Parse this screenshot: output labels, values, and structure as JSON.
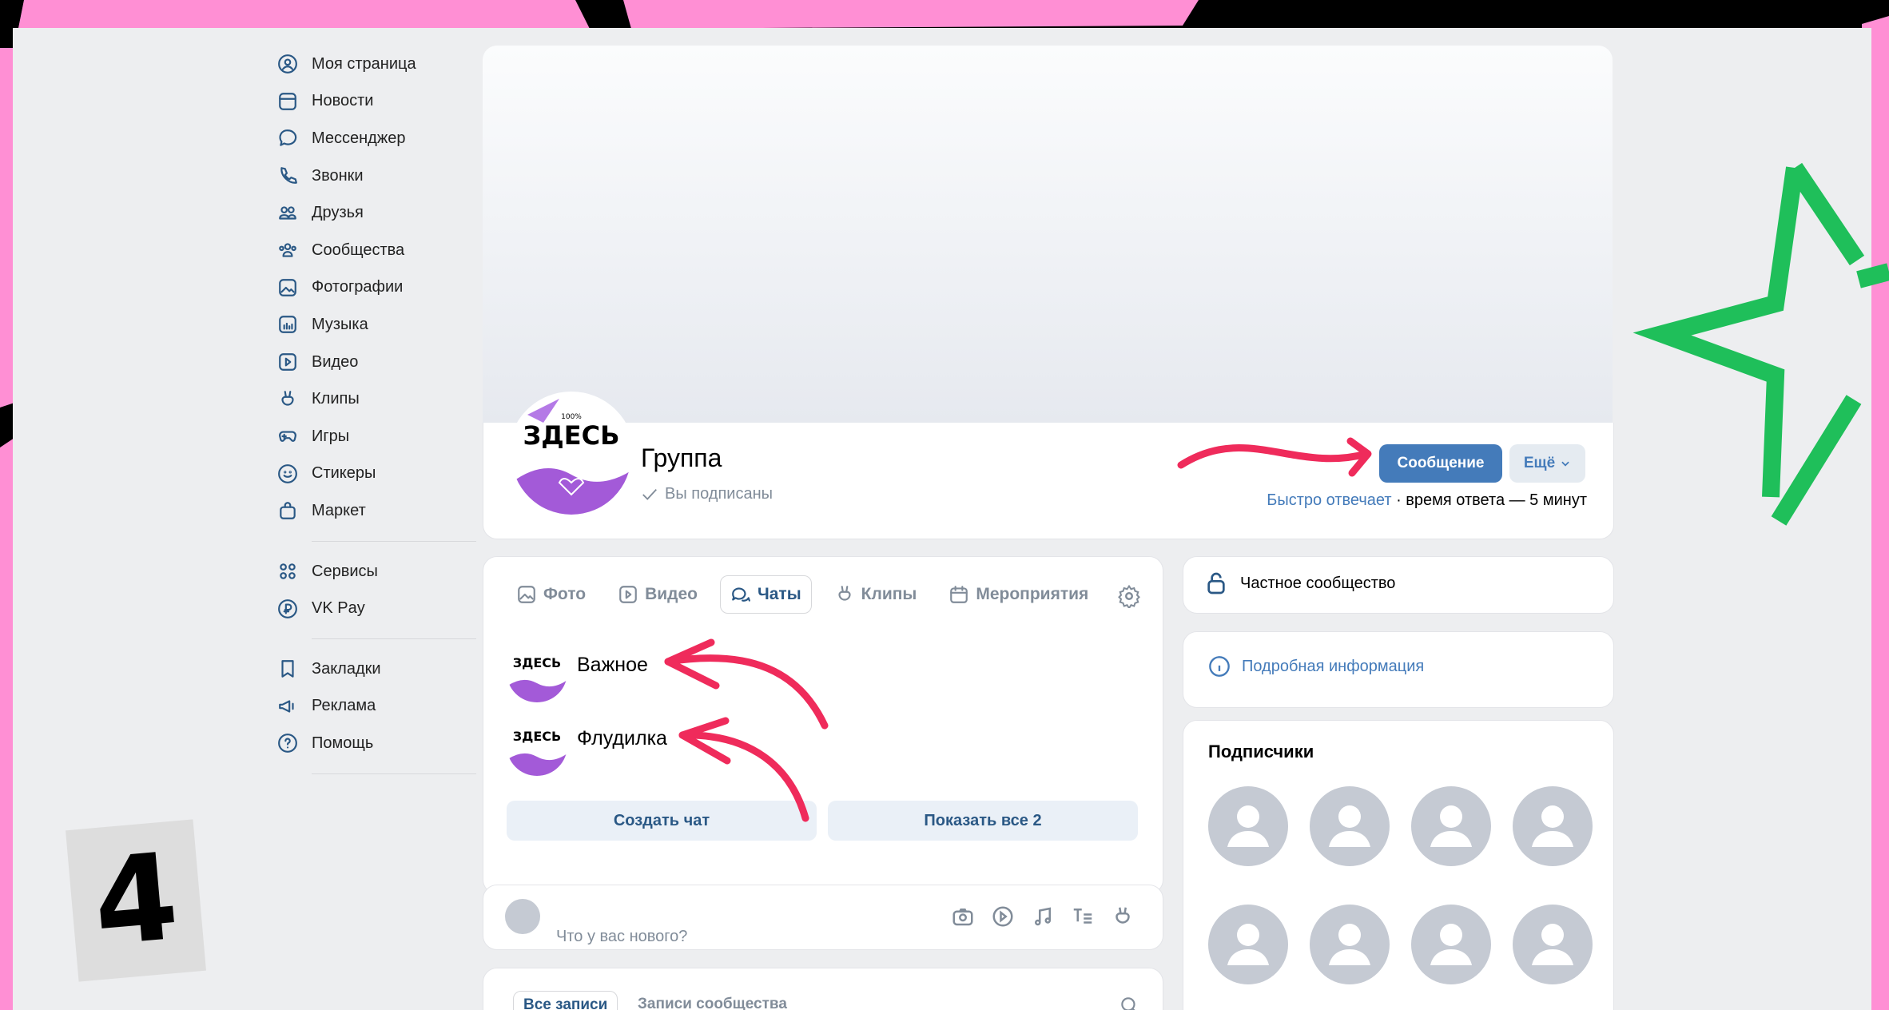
{
  "step_number": "4",
  "sidebar": {
    "items": [
      {
        "label": "Моя страница",
        "icon": "user-circle-icon"
      },
      {
        "label": "Новости",
        "icon": "news-icon"
      },
      {
        "label": "Мессенджер",
        "icon": "message-bubble-icon"
      },
      {
        "label": "Звонки",
        "icon": "phone-icon"
      },
      {
        "label": "Друзья",
        "icon": "friends-icon"
      },
      {
        "label": "Сообщества",
        "icon": "communities-icon"
      },
      {
        "label": "Фотографии",
        "icon": "photo-icon"
      },
      {
        "label": "Музыка",
        "icon": "music-icon"
      },
      {
        "label": "Видео",
        "icon": "video-icon"
      },
      {
        "label": "Клипы",
        "icon": "clips-icon"
      },
      {
        "label": "Игры",
        "icon": "gamepad-icon"
      },
      {
        "label": "Стикеры",
        "icon": "smile-icon"
      },
      {
        "label": "Маркет",
        "icon": "bag-icon"
      }
    ],
    "items2": [
      {
        "label": "Сервисы",
        "icon": "services-icon"
      },
      {
        "label": "VK Pay",
        "icon": "vkpay-icon"
      }
    ],
    "items3": [
      {
        "label": "Закладки",
        "icon": "bookmark-icon"
      },
      {
        "label": "Реклама",
        "icon": "megaphone-icon"
      },
      {
        "label": "Помощь",
        "icon": "help-icon"
      }
    ]
  },
  "group": {
    "avatar_text": "ЗДЕСЬ",
    "avatar_top_text": "100%",
    "name": "Группа",
    "subscribed": "Вы подписаны",
    "message_button": "Сообщение",
    "more_button": "Ещё",
    "response_fast": "Быстро отвечает",
    "response_time": "время ответа — 5 минут"
  },
  "tabs": [
    {
      "label": "Фото",
      "icon": "photo-icon"
    },
    {
      "label": "Видео",
      "icon": "video-icon"
    },
    {
      "label": "Чаты",
      "icon": "chats-icon"
    },
    {
      "label": "Клипы",
      "icon": "clips-icon"
    },
    {
      "label": "Мероприятия",
      "icon": "calendar-icon"
    }
  ],
  "chats": [
    {
      "name": "Важное"
    },
    {
      "name": "Флудилка"
    }
  ],
  "buttons": {
    "create_chat": "Создать чат",
    "show_all": "Показать все 2"
  },
  "composer": {
    "placeholder": "Что у вас нового?"
  },
  "wall_tabs": {
    "all": "Все записи",
    "community": "Записи сообщества"
  },
  "right": {
    "private": "Частное сообщество",
    "details": "Подробная информация",
    "subscribers_title": "Подписчики"
  },
  "colors": {
    "accent": "#447bba",
    "arrow": "#ef2b5b",
    "star": "#1fbf5a",
    "pink": "#ff8fd4"
  }
}
